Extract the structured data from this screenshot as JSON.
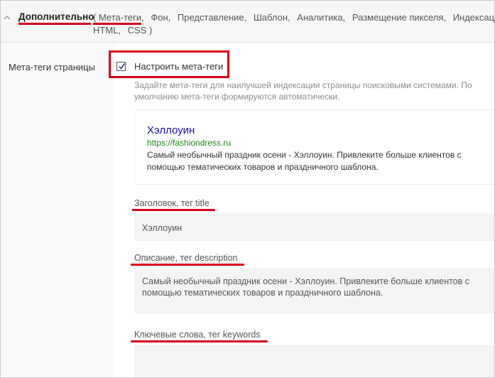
{
  "header": {
    "section_title": "Дополнительно",
    "tabs_line1": [
      {
        "label": "( Мета-теги,"
      },
      {
        "label": "Фон,"
      },
      {
        "label": "Представление,"
      },
      {
        "label": "Шаблон,"
      },
      {
        "label": "Аналитика,"
      },
      {
        "label": "Размещение пикселя,"
      },
      {
        "label": "Индексация,"
      }
    ],
    "tabs_line2": [
      {
        "label": "HTML,"
      },
      {
        "label": "CSS )"
      }
    ]
  },
  "meta": {
    "row_label": "Мета-теги страницы",
    "checkbox_label": "Настроить мета-теги",
    "checkbox_checked": true,
    "hint": "Задайте мета-теги для наилучшей индексации страницы поисковыми системами. По умолчанию мета-теги формируются автоматически."
  },
  "preview": {
    "title": "Хэллоуин",
    "url": "https://fashiondress.ru",
    "description": "Самый необычный праздник осени - Хэллоуин. Привлеките больше клиентов с помощью тематических товаров и праздничного шаблона."
  },
  "fields": {
    "title_label": "Заголовок, тег title",
    "title_value": "Хэллоуин",
    "description_label": "Описание, тег description",
    "description_value": "Самый необычный праздник осени - Хэллоуин. Привлеките больше клиентов с помощью тематических товаров и праздничного шаблона.",
    "keywords_label": "Ключевые слова, тег keywords",
    "keywords_value": ""
  },
  "colors": {
    "annotation_red": "#d9001b",
    "link_blue": "#1a0dab",
    "url_green": "#1a8a1a"
  }
}
